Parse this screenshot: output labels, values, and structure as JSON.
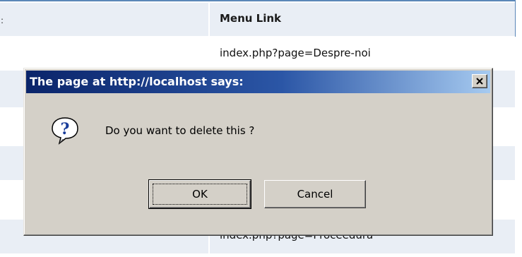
{
  "table": {
    "header_col1_fragment": ":",
    "header_col2": "Menu Link",
    "rows": [
      {
        "link": "index.php?page=Despre-noi"
      },
      {
        "link": "index.php?page=Proceedura"
      }
    ]
  },
  "dialog": {
    "title": "The page at http://localhost says:",
    "message": "Do you want to delete this ?",
    "ok_label": "OK",
    "cancel_label": "Cancel",
    "icon": "question-icon",
    "close_icon": "close-icon"
  },
  "colors": {
    "row_shade": "#e9eef5",
    "rule": "#5b87b8",
    "dialog_face": "#d4d0c8",
    "title_start": "#0a246a",
    "title_end": "#a6caf0"
  }
}
